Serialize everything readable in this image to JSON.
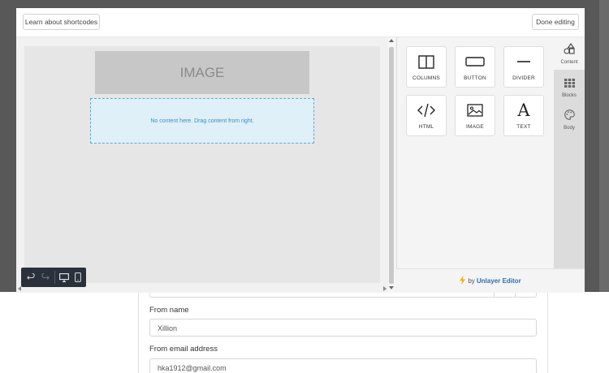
{
  "modal": {
    "learn_label": "Learn about shortcodes",
    "done_label": "Done editing"
  },
  "canvas": {
    "image_placeholder": "IMAGE",
    "empty_message": "No content here. Drag content from right."
  },
  "tools": [
    {
      "label": "COLUMNS",
      "icon": "columns-icon"
    },
    {
      "label": "BUTTON",
      "icon": "button-icon"
    },
    {
      "label": "DIVIDER",
      "icon": "divider-icon"
    },
    {
      "label": "HTML",
      "icon": "code-icon"
    },
    {
      "label": "IMAGE",
      "icon": "image-icon"
    },
    {
      "label": "TEXT",
      "icon": "text-icon"
    }
  ],
  "tabs": [
    {
      "label": "Content",
      "icon": "shapes-icon",
      "active": true
    },
    {
      "label": "Blocks",
      "icon": "grid-icon",
      "active": false
    },
    {
      "label": "Body",
      "icon": "palette-icon",
      "active": false
    }
  ],
  "footer": {
    "prefix": "by",
    "brand": "Unlayer Editor"
  },
  "form": {
    "from_name_label": "From name",
    "from_name_value": "Xillion",
    "from_email_label": "From email address",
    "from_email_value": "hka1912@gmail.com"
  },
  "colors": {
    "accent_blue": "#2b6fb5",
    "drop_zone": "#dff0f8",
    "bolt": "#f5b400",
    "toolbar": "#2b313b"
  }
}
